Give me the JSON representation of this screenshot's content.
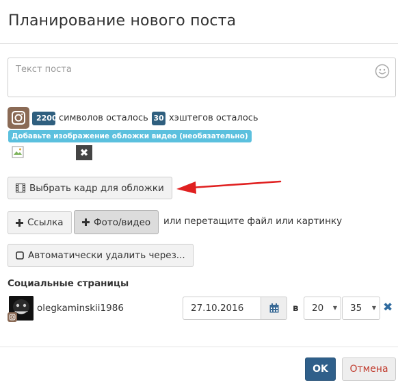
{
  "modal": {
    "title": "Планирование нового поста"
  },
  "post": {
    "placeholder": "Текст поста"
  },
  "counters": {
    "chars_count": "2200",
    "chars_label": "символов осталось",
    "hashtags_count": "30",
    "hashtags_label": "хэштегов осталось"
  },
  "cover_hint": "Добавьте изображение обложки видео (необязательно)",
  "cover_delete": "✖",
  "buttons": {
    "choose_frame": "Выбрать кадр для обложки",
    "link": "Ссылка",
    "photo_video": "Фото/видео",
    "drag_hint": "или перетащите файл или картинку",
    "auto_delete": "Автоматически удалить через..."
  },
  "social": {
    "section_title": "Социальные страницы",
    "account": "olegkaminskii1986",
    "date": "27.10.2016",
    "at_label": "в",
    "hour": "20",
    "minute": "35",
    "remove": "✖"
  },
  "footer": {
    "ok": "OK",
    "cancel": "Отмена"
  },
  "colors": {
    "primary": "#2f5f8a",
    "badge": "#2f5f7f",
    "hint": "#5bc0de",
    "instagram": "#8a6a55",
    "cancel_text": "#c0392b",
    "annotation_arrow": "#e02020"
  },
  "icons": {
    "smiley": "smiley-icon",
    "instagram": "instagram-icon",
    "film": "film-icon",
    "plus": "plus-icon",
    "checkbox": "checkbox-icon",
    "calendar": "calendar-icon",
    "broken_image": "broken-image-icon"
  }
}
